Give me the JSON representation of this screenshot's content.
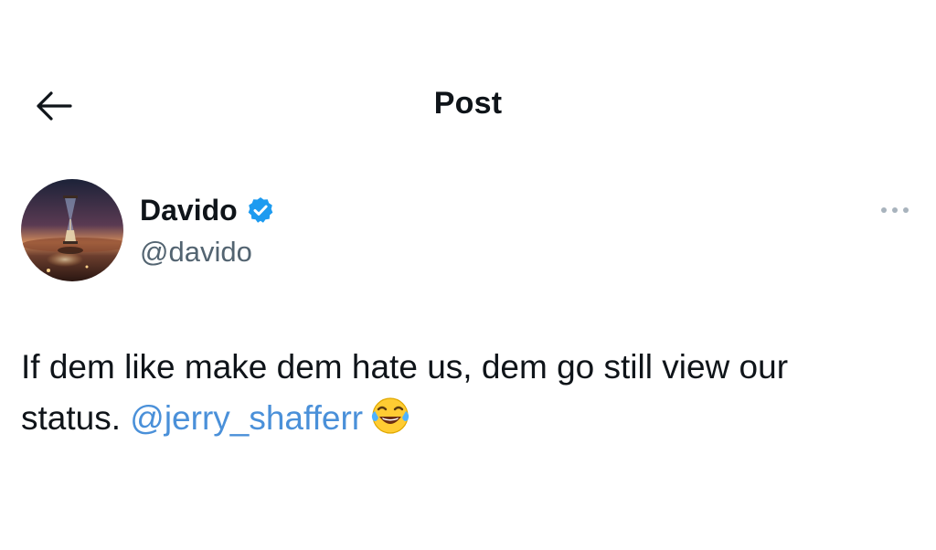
{
  "header": {
    "title": "Post",
    "back_icon": "arrow-left-icon"
  },
  "author": {
    "display_name": "Davido",
    "handle": "@davido",
    "verified": true,
    "verified_color": "#1d9bf0",
    "avatar_icon": "hourglass-desert-avatar"
  },
  "menu": {
    "icon": "more-horizontal-icon"
  },
  "post": {
    "text_line1": "If dem like make dem hate us, dem go still view our",
    "text_line2": "status.",
    "mention": "@jerry_shafferr",
    "emoji": "face-with-tears-of-joy-emoji",
    "mention_color": "#4a90d9"
  }
}
